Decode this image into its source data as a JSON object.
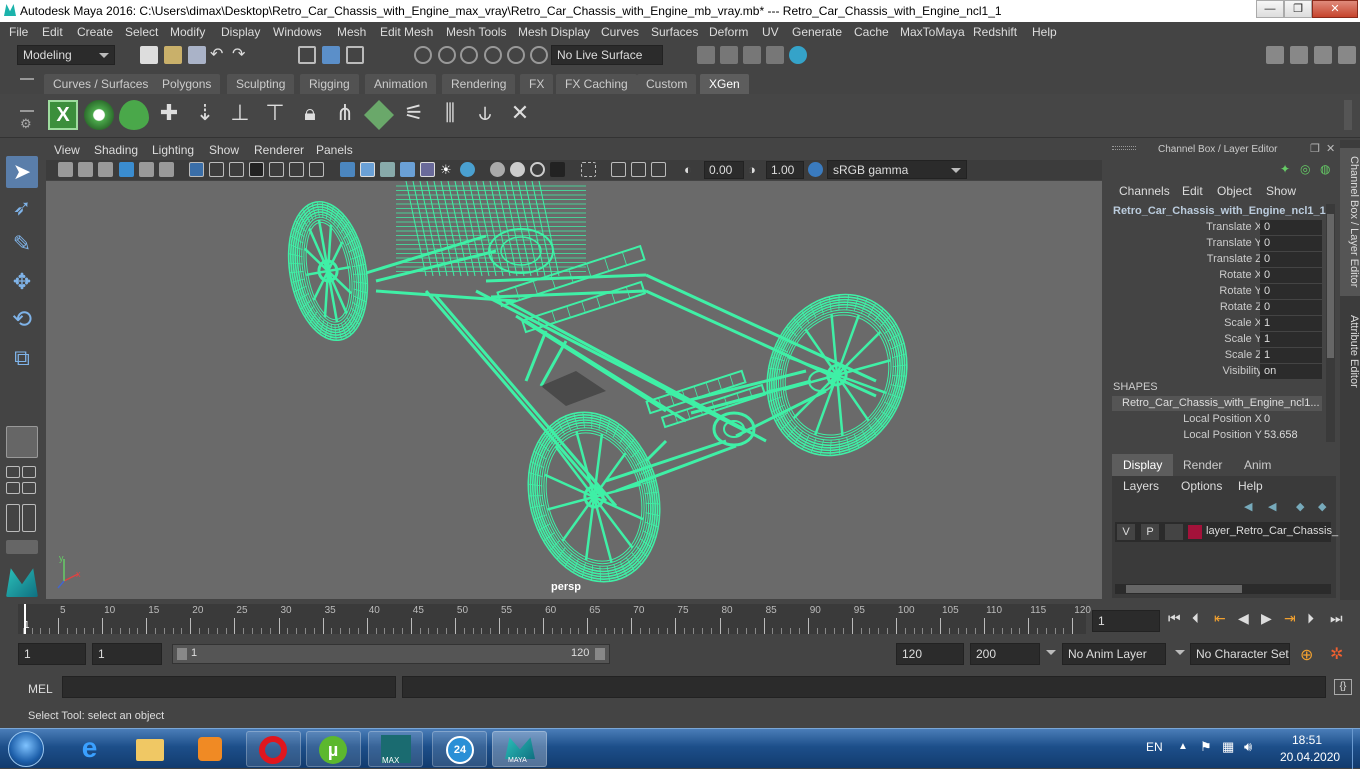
{
  "window": {
    "title": "Autodesk Maya 2016: C:\\Users\\dimax\\Desktop\\Retro_Car_Chassis_with_Engine_max_vray\\Retro_Car_Chassis_with_Engine_mb_vray.mb*   ---   Retro_Car_Chassis_with_Engine_ncl1_1",
    "minimize_glyph": "—",
    "maximize_glyph": "❐",
    "close_glyph": "✕"
  },
  "menubar": [
    "File",
    "Edit",
    "Create",
    "Select",
    "Modify",
    "Display",
    "Windows",
    "Mesh",
    "Edit Mesh",
    "Mesh Tools",
    "Mesh Display",
    "Curves",
    "Surfaces",
    "Deform",
    "UV",
    "Generate",
    "Cache",
    "MaxToMaya",
    "Redshift",
    "Help"
  ],
  "statusline": {
    "mode": "Modeling",
    "live_surface": "No Live Surface"
  },
  "shelf": {
    "tabs": [
      "Curves / Surfaces",
      "Polygons",
      "Sculpting",
      "Rigging",
      "Animation",
      "Rendering",
      "FX",
      "FX Caching",
      "Custom",
      "XGen"
    ],
    "active": "XGen"
  },
  "viewport": {
    "menus": [
      "View",
      "Shading",
      "Lighting",
      "Show",
      "Renderer",
      "Panels"
    ],
    "exposure": "0.00",
    "gamma": "1.00",
    "color_space": "sRGB gamma",
    "camera_label": "persp",
    "axis_x": "x",
    "axis_y": "y",
    "wire_color": "#3ff0a6"
  },
  "channelbox": {
    "title": "Channel Box / Layer Editor",
    "menus": [
      "Channels",
      "Edit",
      "Object",
      "Show"
    ],
    "object_name": "Retro_Car_Chassis_with_Engine_ncl1_1",
    "attributes": [
      {
        "label": "Translate X",
        "value": "0"
      },
      {
        "label": "Translate Y",
        "value": "0"
      },
      {
        "label": "Translate Z",
        "value": "0"
      },
      {
        "label": "Rotate X",
        "value": "0"
      },
      {
        "label": "Rotate Y",
        "value": "0"
      },
      {
        "label": "Rotate Z",
        "value": "0"
      },
      {
        "label": "Scale X",
        "value": "1"
      },
      {
        "label": "Scale Y",
        "value": "1"
      },
      {
        "label": "Scale Z",
        "value": "1"
      },
      {
        "label": "Visibility",
        "value": "on"
      }
    ],
    "shapes_header": "SHAPES",
    "shape_name": "Retro_Car_Chassis_with_Engine_ncl1...",
    "shape_attributes": [
      {
        "label": "Local Position X",
        "value": "0"
      },
      {
        "label": "Local Position Y",
        "value": "53.658"
      }
    ]
  },
  "layer_editor": {
    "tabs": [
      "Display",
      "Render",
      "Anim"
    ],
    "active": "Display",
    "menus": [
      "Layers",
      "Options",
      "Help"
    ],
    "layer": {
      "v": "V",
      "p": "P",
      "color": "#a3123a",
      "name": "layer_Retro_Car_Chassis_"
    }
  },
  "side_tabs": [
    "Channel Box / Layer Editor",
    "Attribute Editor"
  ],
  "timeline": {
    "ticks": [
      "5",
      "10",
      "15",
      "20",
      "25",
      "30",
      "35",
      "40",
      "45",
      "50",
      "55",
      "60",
      "65",
      "70",
      "75",
      "80",
      "85",
      "90",
      "95",
      "100",
      "105",
      "110",
      "115",
      "120"
    ],
    "current_marker": "1",
    "current_frame": "1"
  },
  "range": {
    "start": "1",
    "playback_start": "1",
    "slider_start": "1",
    "slider_end": "120",
    "playback_end": "120",
    "end": "200",
    "anim_layer": "No Anim Layer",
    "character_set": "No Character Set"
  },
  "cmdline": {
    "label": "MEL"
  },
  "helpline": {
    "text": "Select Tool: select an object"
  },
  "taskbar": {
    "lang": "EN",
    "time": "18:51",
    "date": "20.04.2020",
    "badge_24": "24",
    "max_label": "MAX",
    "maya_label": "MAYA"
  }
}
